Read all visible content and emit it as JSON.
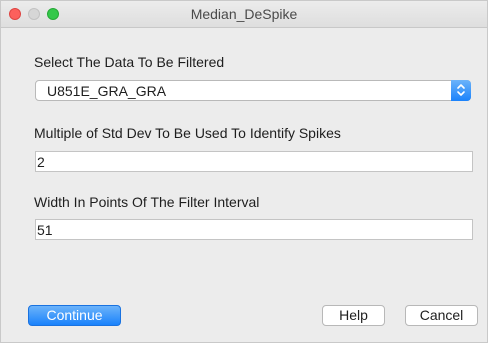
{
  "window": {
    "title": "Median_DeSpike"
  },
  "data_select": {
    "label": "Select The Data To Be Filtered",
    "value": "U851E_GRA_GRA",
    "icon": "chevron-up-down-icon"
  },
  "std_dev_field": {
    "label": "Multiple of Std Dev To Be Used To Identify Spikes",
    "value": "2"
  },
  "width_field": {
    "label": "Width In Points Of The Filter Interval",
    "value": "51"
  },
  "buttons": {
    "continue_label": "Continue",
    "help_label": "Help",
    "cancel_label": "Cancel"
  },
  "colors": {
    "accent": "#1a82fb",
    "close": "#fc605c",
    "zoom": "#34c84a"
  }
}
